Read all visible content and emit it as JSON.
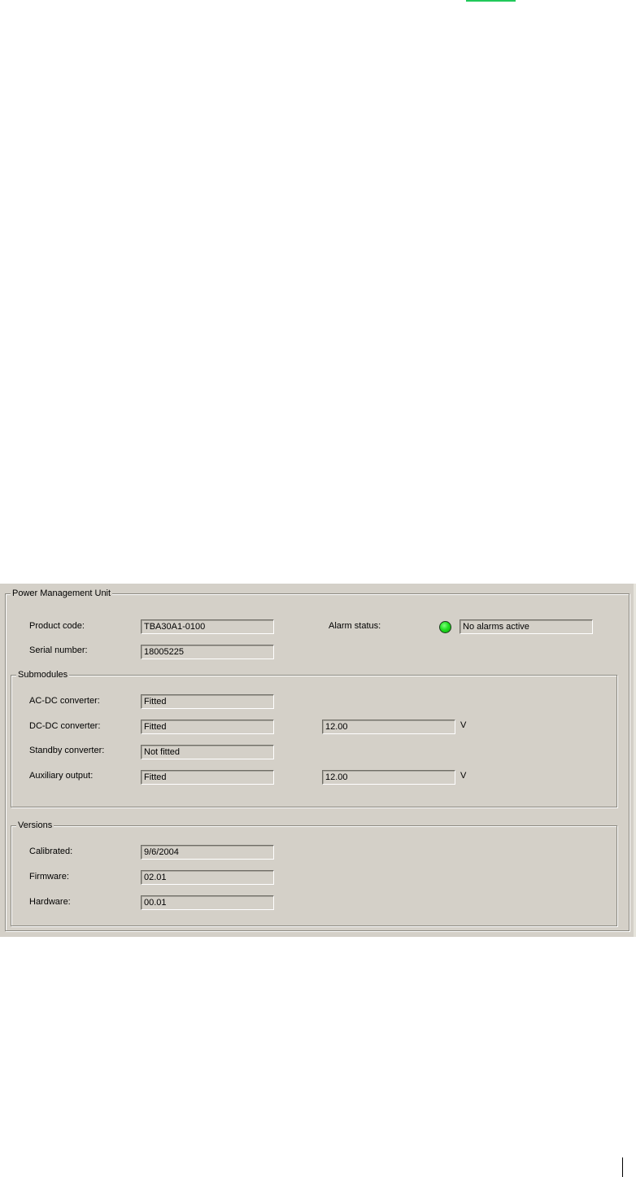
{
  "page": {
    "top_marker_color": "#21c95a"
  },
  "pmu": {
    "title": "Power Management Unit",
    "product_code_label": "Product code:",
    "product_code_value": "TBA30A1-0100",
    "serial_number_label": "Serial number:",
    "serial_number_value": "18005225",
    "alarm_status_label": "Alarm status:",
    "alarm_status_value": "No alarms active",
    "alarm_led_color": "#22e022"
  },
  "submodules": {
    "title": "Submodules",
    "rows": [
      {
        "label": "AC-DC converter:",
        "status": "Fitted"
      },
      {
        "label": "DC-DC converter:",
        "status": "Fitted",
        "voltage": "12.00",
        "unit": "V"
      },
      {
        "label": "Standby converter:",
        "status": "Not fitted"
      },
      {
        "label": "Auxiliary output:",
        "status": "Fitted",
        "voltage": "12.00",
        "unit": "V"
      }
    ]
  },
  "versions": {
    "title": "Versions",
    "rows": [
      {
        "label": "Calibrated:",
        "value": "9/6/2004"
      },
      {
        "label": "Firmware:",
        "value": "02.01"
      },
      {
        "label": "Hardware:",
        "value": "00.01"
      }
    ]
  }
}
